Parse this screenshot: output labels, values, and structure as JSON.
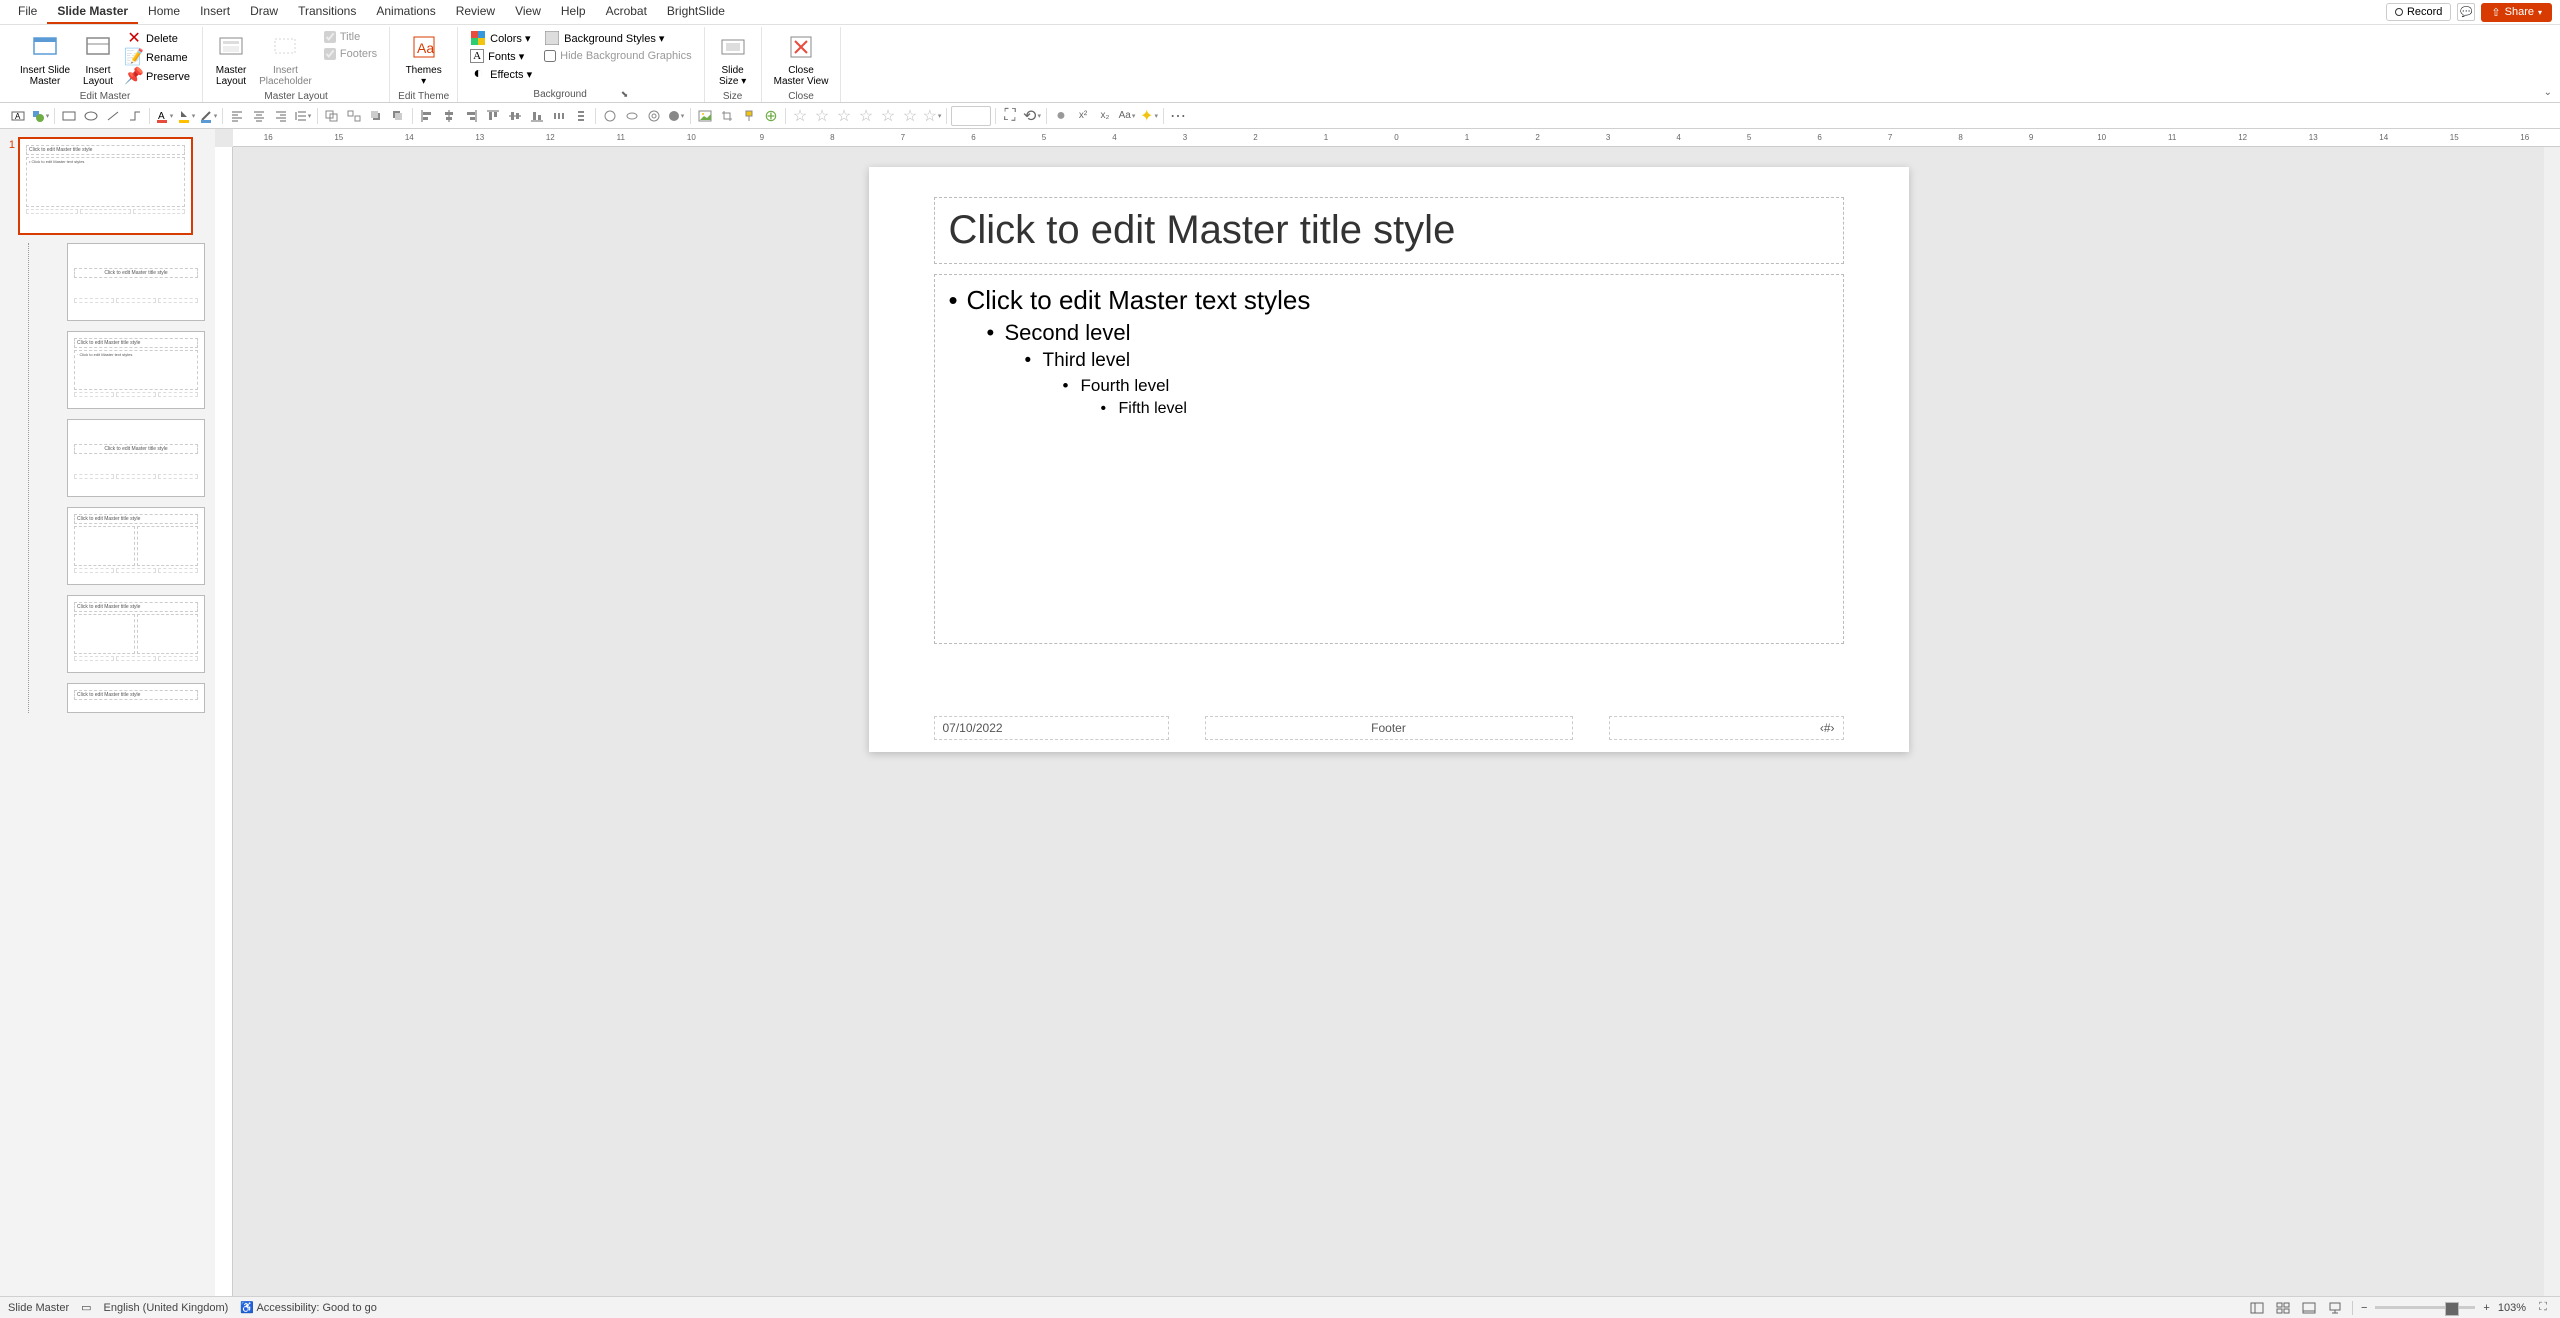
{
  "menu": {
    "tabs": [
      "File",
      "Slide Master",
      "Home",
      "Insert",
      "Draw",
      "Transitions",
      "Animations",
      "Review",
      "View",
      "Help",
      "Acrobat",
      "BrightSlide"
    ],
    "active_index": 1,
    "record": "Record",
    "share": "Share"
  },
  "ribbon": {
    "groups": {
      "edit_master": {
        "label": "Edit Master",
        "insert_slide_master": "Insert Slide\nMaster",
        "insert_layout": "Insert\nLayout",
        "delete": "Delete",
        "rename": "Rename",
        "preserve": "Preserve"
      },
      "master_layout": {
        "label": "Master Layout",
        "master_layout_btn": "Master\nLayout",
        "insert_placeholder": "Insert\nPlaceholder",
        "title_chk": "Title",
        "footers_chk": "Footers"
      },
      "edit_theme": {
        "label": "Edit Theme",
        "themes": "Themes"
      },
      "background": {
        "label": "Background",
        "colors": "Colors",
        "fonts": "Fonts",
        "effects": "Effects",
        "bg_styles": "Background Styles",
        "hide_bg": "Hide Background Graphics"
      },
      "size": {
        "label": "Size",
        "slide_size": "Slide\nSize"
      },
      "close": {
        "label": "Close",
        "close_master": "Close\nMaster View"
      }
    }
  },
  "slide": {
    "title_placeholder": "Click to edit Master title style",
    "body_levels": [
      "Click to edit Master text styles",
      "Second level",
      "Third level",
      "Fourth level",
      "Fifth level"
    ],
    "date": "07/10/2022",
    "footer": "Footer",
    "slide_number": "‹#›"
  },
  "thumbnails": {
    "master_num": "1",
    "master_title": "Click to edit Master title style",
    "master_body": "• Click to edit Master text styles",
    "layouts": [
      "Click to edit Master title style",
      "Click to edit Master title style",
      "Click to edit Master title style",
      "Click to edit Master title style",
      "Click to edit Master title style",
      "Click to edit Master title style"
    ]
  },
  "statusbar": {
    "view_name": "Slide Master",
    "language": "English (United Kingdom)",
    "accessibility": "Accessibility: Good to go",
    "zoom": "103%"
  },
  "ruler_ticks": [
    "16",
    "15",
    "14",
    "13",
    "12",
    "11",
    "10",
    "9",
    "8",
    "7",
    "6",
    "5",
    "4",
    "3",
    "2",
    "1",
    "0",
    "1",
    "2",
    "3",
    "4",
    "5",
    "6",
    "7",
    "8",
    "9",
    "10",
    "11",
    "12",
    "13",
    "14",
    "15",
    "16"
  ]
}
